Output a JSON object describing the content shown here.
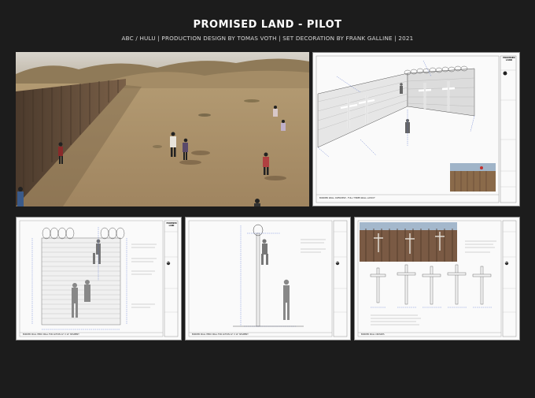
{
  "header": {
    "title": "PROMISED LAND - PILOT",
    "credits": "ABC / HULU | PRODUCTION DESIGN BY TOMAS VOTH | SET DECORATION BY FRANK GALLINE | 2021"
  },
  "panels": {
    "overview": {
      "caption": "BORDER WALL OVERVIEW - FULL THREE-WALL LAYOUT",
      "tb_title": "PROMISED LAND",
      "brand": "abc"
    },
    "hero": {
      "caption": "BORDER WALL HERO WALL FOR ACTION 12' X 12' SEGMENT",
      "tb_title": "PROMISED LAND",
      "brand": "abc"
    },
    "climb": {
      "caption": "BORDER WALL HERO WALL FOR ACTION 12' X 12' SEGMENT",
      "brand": "abc"
    },
    "crosses": {
      "caption": "BORDER WALL CROSSES",
      "brand": "abc"
    }
  }
}
